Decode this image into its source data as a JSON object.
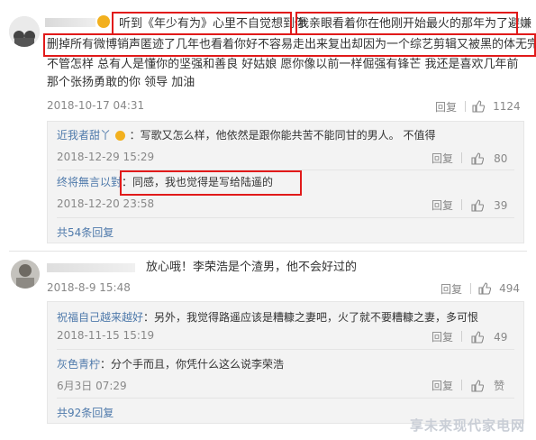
{
  "comment1": {
    "username_masked": "",
    "text_segments": [
      "听到《年少有为》心里不自觉想到你",
      "我亲眼看着你在他刚开始最火的那年为了避嫌",
      "删掉所有微博销声匿迹了几年也看着你好不容易走出来复出却因为一个综艺剪辑又被黑的体无完肤",
      "不管怎样 总有人是懂你的坚强和善良 好姑娘 愿你像以前一样倔强有锋芒 我还是喜欢几年前那个张扬勇敢的你 领导 加油"
    ],
    "time": "2018-10-17 04:31",
    "reply_label": "回复",
    "like_count": "1124",
    "replies": [
      {
        "user": "近我者甜丫",
        "text": "：写歌又怎么样，他依然是跟你能共苦不能同甘的男人。  不值得",
        "time": "2018-12-29 15:29",
        "reply_label": "回复",
        "like_count": "80"
      },
      {
        "user": "终将無言以對",
        "text": "：同感，我也觉得是写给陆遥的",
        "time": "2018-12-20 23:58",
        "reply_label": "回复",
        "like_count": "39"
      }
    ],
    "more_replies": "共54条回复"
  },
  "comment2": {
    "text": "放心哦！李荣浩是个渣男，他不会好过的",
    "time": "2018-8-9 15:48",
    "reply_label": "回复",
    "like_count": "494",
    "replies": [
      {
        "user": "祝福自己越来越好",
        "text": "：另外，我觉得路遥应该是糟糠之妻吧，火了就不要糟糠之妻，多可恨",
        "time": "2018-11-15 15:19",
        "reply_label": "回复",
        "like_count": "49"
      },
      {
        "user": "灰色青柠",
        "text": "：分个手而且，你凭什么这么说李荣浩",
        "time": "6月3日 07:29",
        "reply_label": "回复",
        "like_count": "赞"
      }
    ],
    "more_replies": "共92条回复"
  },
  "watermark": "享未来现代家电网",
  "colors": {
    "link": "#4f7aab",
    "highlight_box": "#e11a1a",
    "reply_bg": "#f3f3f3"
  }
}
